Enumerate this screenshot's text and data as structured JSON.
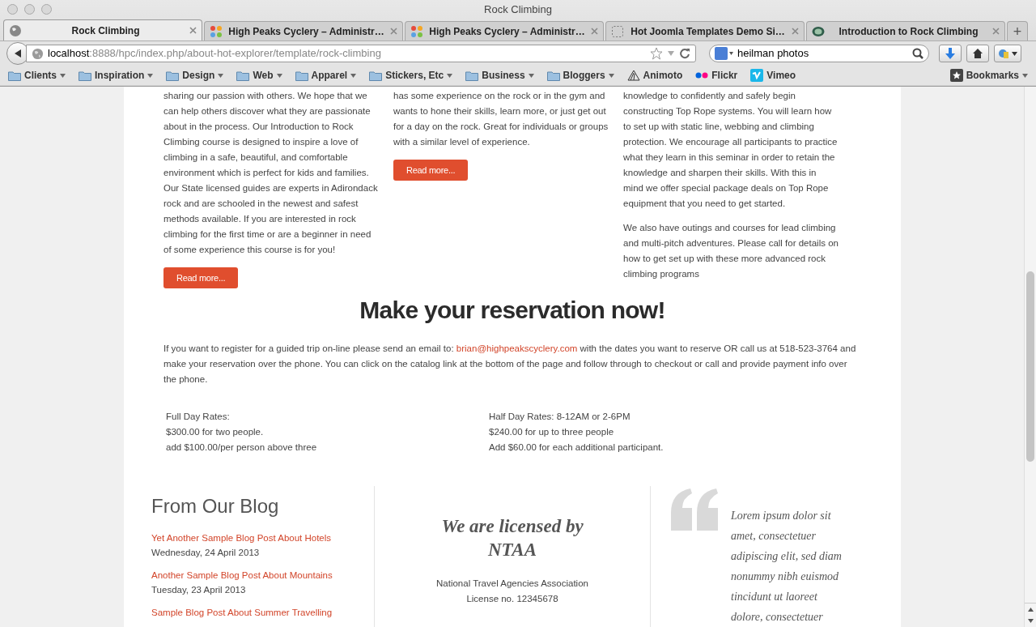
{
  "window": {
    "title": "Rock Climbing"
  },
  "tabs": [
    {
      "label": "Rock Climbing",
      "selected": true,
      "kind": "globe"
    },
    {
      "label": "High Peaks Cyclery – Administr…",
      "selected": false,
      "kind": "joomla"
    },
    {
      "label": "High Peaks Cyclery – Administr…",
      "selected": false,
      "kind": "joomla"
    },
    {
      "label": "Hot Joomla Templates Demo Si…",
      "selected": false,
      "kind": "blank"
    },
    {
      "label": "Introduction to Rock Climbing",
      "selected": false,
      "kind": "badge"
    }
  ],
  "new_tab": "+",
  "address": {
    "host": "localhost",
    "path": ":8888/hpc/index.php/about-hot-explorer/template/rock-climbing"
  },
  "search": {
    "value": "heilman photos"
  },
  "bookmarks": [
    {
      "label": "Clients",
      "kind": "folder"
    },
    {
      "label": "Inspiration",
      "kind": "folder"
    },
    {
      "label": "Design",
      "kind": "folder"
    },
    {
      "label": "Web",
      "kind": "folder"
    },
    {
      "label": "Apparel",
      "kind": "folder"
    },
    {
      "label": "Stickers, Etc",
      "kind": "folder"
    },
    {
      "label": "Business",
      "kind": "folder"
    },
    {
      "label": "Bloggers",
      "kind": "folder"
    },
    {
      "label": "Animoto",
      "kind": "animoto"
    },
    {
      "label": "Flickr",
      "kind": "flickr"
    },
    {
      "label": "Vimeo",
      "kind": "vimeo"
    }
  ],
  "bookmarks_menu": "Bookmarks",
  "columns": [
    {
      "paragraphs": [
        [
          "sharing our passion with others.  We hope that we",
          "can help others discover what they are passionate",
          "about in the process.  Our Introduction to Rock",
          "Climbing course is designed to inspire a love of",
          "climbing in a safe, beautiful, and comfortable",
          "environment which is perfect for kids and families.",
          "Our State licensed guides are experts in Adirondack",
          "rock and are schooled in the newest and safest",
          "methods available.  If you are interested in rock",
          "climbing for the first time or are a beginner in need",
          "of some experience this course is for you!"
        ]
      ],
      "button": "Read more..."
    },
    {
      "paragraphs": [
        [
          "has some experience on the rock or in the gym and",
          "wants to hone their skills, learn more, or just get out",
          "for a day on the rock. Great for individuals or groups",
          "with a similar level of experience."
        ]
      ],
      "button": "Read more..."
    },
    {
      "paragraphs": [
        [
          "knowledge to confidently and safely begin",
          "constructing Top Rope systems. You will learn how",
          "to set up with static line, webbing and climbing",
          "protection. We encourage all participants to practice",
          "what they learn in this seminar in order to retain the",
          "knowledge and sharpen their skills.  With this in",
          "mind we offer special package deals on Top Rope",
          "equipment that you need to get started."
        ],
        [
          "We also have outings and courses for lead climbing",
          "and multi-pitch adventures. Please call for details on",
          "how to get set up with these more advanced rock",
          "climbing programs"
        ]
      ]
    }
  ],
  "reservation": {
    "heading": "Make your reservation now!",
    "before": "If you want to register for a guided trip on-line please send an email to:",
    "email": "brian@highpeakscyclery.com",
    "after": "with the dates you want to reserve OR call us at 518-523-3764 and make your reservation over the phone. You can click on the catalog link at the bottom of the page and follow through to checkout or call and provide payment info over the phone."
  },
  "rates": [
    [
      "Full Day Rates:",
      "$300.00 for two people.",
      "add $100.00/per person above three"
    ],
    [
      "Half Day Rates: 8-12AM or 2-6PM",
      "$240.00 for up to three people",
      "Add $60.00 for each additional participant."
    ]
  ],
  "blog": {
    "title": "From Our Blog",
    "posts": [
      {
        "title": "Yet Another Sample Blog Post About Hotels",
        "date": "Wednesday, 24 April 2013"
      },
      {
        "title": "Another Sample Blog Post About Mountains",
        "date": "Tuesday, 23 April 2013"
      },
      {
        "title": "Sample Blog Post About Summer Travelling"
      }
    ]
  },
  "license": {
    "heading": "We are licensed by NTAA",
    "lines": [
      "National Travel Agencies Association",
      "License no. 12345678"
    ]
  },
  "quote": [
    "Lorem ipsum dolor sit",
    "amet, consectetuer",
    "adipiscing elit, sed diam",
    "nonummy nibh euismod",
    "tincidunt ut laoreet",
    "dolore, consectetuer"
  ]
}
